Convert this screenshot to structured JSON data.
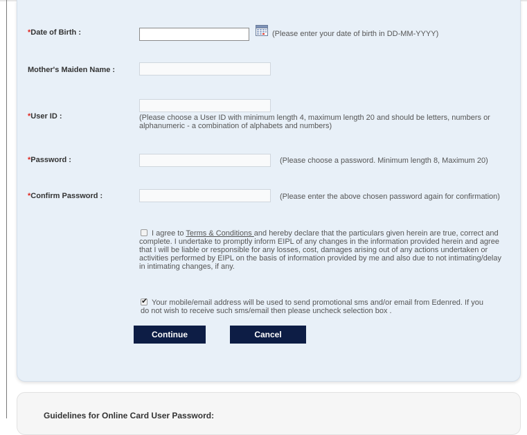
{
  "form": {
    "dob": {
      "required_mark": "*",
      "label": "Date of Birth :",
      "value": "",
      "hint": "(Please enter your date of birth in DD-MM-YYYY)",
      "icon": "calendar-icon"
    },
    "maiden_name": {
      "label": "Mother's Maiden Name :",
      "value": ""
    },
    "user_id": {
      "required_mark": "*",
      "label": "User ID :",
      "value": "",
      "hint": "(Please choose a User ID with minimum length 4, maximum length 20 and should be letters, numbers or alphanumeric - a combination of alphabets and numbers)"
    },
    "password": {
      "required_mark": "*",
      "label": "Password :",
      "value": "",
      "hint": "(Please choose a password. Minimum length 8, Maximum 20)"
    },
    "confirm_password": {
      "required_mark": "*",
      "label": "Confirm Password :",
      "value": "",
      "hint": "(Please enter the above chosen password again for confirmation)"
    },
    "terms": {
      "checked": false,
      "text_before": "I agree to ",
      "link_text": "Terms & Conditions ",
      "text_after": "and hereby declare that the particulars given herein are true, correct and complete. I undertake to promptly inform EIPL of any changes in the information provided herein and agree that I will be liable or responsible for any losses, cost, damages arising out of any actions undertaken or activities performed by EIPL on the basis of information provided by me and also due to not intimating/delay in intimating changes, if any."
    },
    "promo": {
      "checked": true,
      "text": "Your mobile/email address will be used to send promotional sms and/or email from Edenred. If you do not wish to receive such sms/email then please uncheck selection box ."
    },
    "buttons": {
      "continue": "Continue",
      "cancel": "Cancel"
    }
  },
  "guidelines": {
    "title": "Guidelines for Online Card User Password:"
  }
}
